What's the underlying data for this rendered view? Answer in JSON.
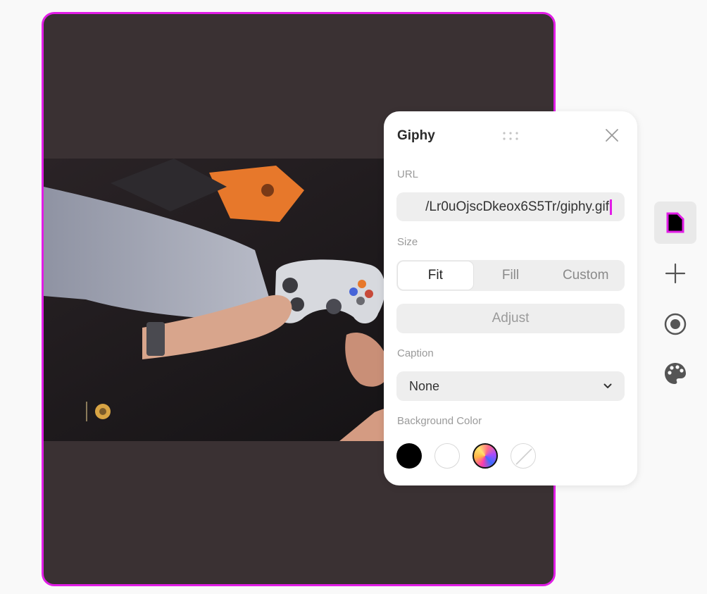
{
  "panel": {
    "title": "Giphy",
    "url_label": "URL",
    "url_value": "/Lr0uOjscDkeox6S5Tr/giphy.gif",
    "size_label": "Size",
    "size_options": [
      {
        "label": "Fit",
        "selected": true
      },
      {
        "label": "Fill",
        "selected": false
      },
      {
        "label": "Custom",
        "selected": false
      }
    ],
    "adjust_label": "Adjust",
    "caption_label": "Caption",
    "caption_value": "None",
    "background_label": "Background Color",
    "swatches": [
      {
        "name": "black",
        "color": "#000000"
      },
      {
        "name": "white",
        "color": "#ffffff"
      },
      {
        "name": "gradient",
        "color": "gradient"
      },
      {
        "name": "none",
        "color": "none"
      }
    ]
  },
  "toolbar": {
    "items": [
      {
        "icon": "document-icon",
        "active": true
      },
      {
        "icon": "plus-icon",
        "active": false
      },
      {
        "icon": "record-icon",
        "active": false
      },
      {
        "icon": "palette-icon",
        "active": false
      }
    ]
  },
  "colors": {
    "accent": "#e11de6",
    "canvas_background": "#3a3133",
    "page_background": "#f9f9f9"
  }
}
